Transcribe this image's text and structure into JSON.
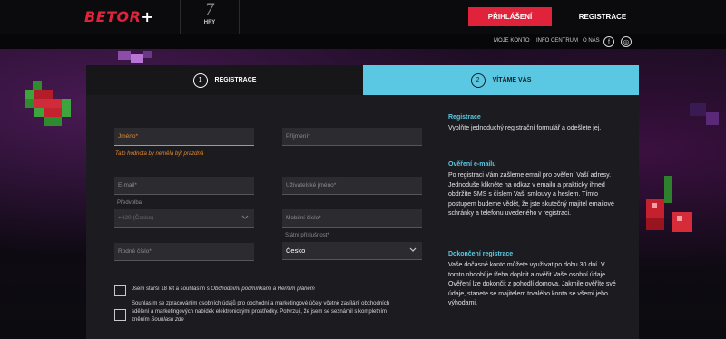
{
  "header": {
    "logo_part1": "BETOR",
    "logo_part2": "+",
    "games_number": "7",
    "games_label": "HRY",
    "login_button": "PŘIHLÁŠENÍ",
    "register_link": "REGISTRACE"
  },
  "subnav": {
    "links": [
      "MOJE KONTO",
      "INFO CENTRUM",
      "O NÁS"
    ],
    "facebook": "f",
    "instagram": "◎"
  },
  "tabs": [
    {
      "number": "1",
      "label": "REGISTRACE"
    },
    {
      "number": "2",
      "label": "VÍTÁME VÁS"
    }
  ],
  "form": {
    "jmeno": {
      "placeholder": "Jméno*",
      "error": "Tato hodnota by neměla být prázdná"
    },
    "prijmeni": {
      "placeholder": "Příjmení*"
    },
    "email": {
      "placeholder": "E-mail*"
    },
    "username": {
      "placeholder": "Uživatelské jméno*"
    },
    "predvolba_label": "Předvolba",
    "predvolba_value": "+420 (Česko)",
    "mobil": {
      "placeholder": "Mobilní číslo*"
    },
    "rodne_cislo": {
      "placeholder": "Rodné číslo*"
    },
    "statni_label": "Státní příslušnost*",
    "statni_value": "Česko"
  },
  "consents": {
    "c1_pre": "Jsem starší 18 let a souhlasím s",
    "c1_link": "Obchodními podmínkami a Herním plánem",
    "c2_line1": "Souhlasím se zpracováním osobních údajů pro obchodní a marketingové účely včetně zasílání obchodních",
    "c2_line2": "sdělení a marketingových nabídek elektronickými prostředky. Potvrzuji, že jsem se seznámil s kompletním",
    "c2_line3_pre": "zněním",
    "c2_link": "Souhlasu zde"
  },
  "info": {
    "s1_title": "Registrace",
    "s1_text": "Vyplňte jednoduchý registrační formulář a odešlete jej.",
    "s2_title": "Ověření e-mailu",
    "s2_text": "Po registraci Vám zašleme email pro ověření Vaší adresy. Jednoduše klikněte na odkaz v emailu a prakticky ihned obdržíte SMS s číslem Vaší smlouvy a heslem. Tímto postupem budeme vědět, že jste skutečný majitel emailové schránky a telefonu uvedeného v registraci.",
    "s3_title": "Dokončení registrace",
    "s3_text": "Vaše dočasné konto můžete využívat po dobu 30 dní. V tomto období je třeba doplnit a ověřit Vaše osobní údaje. Ověření lze dokončit z pohodlí domova. Jakmile ověříte své údaje, stanete se majitelem trvalého konta se všemi jeho výhodami."
  },
  "colors": {
    "brand_red": "#e0223b",
    "accent_cyan": "#5ac8e3",
    "error_orange": "#e8892b"
  }
}
